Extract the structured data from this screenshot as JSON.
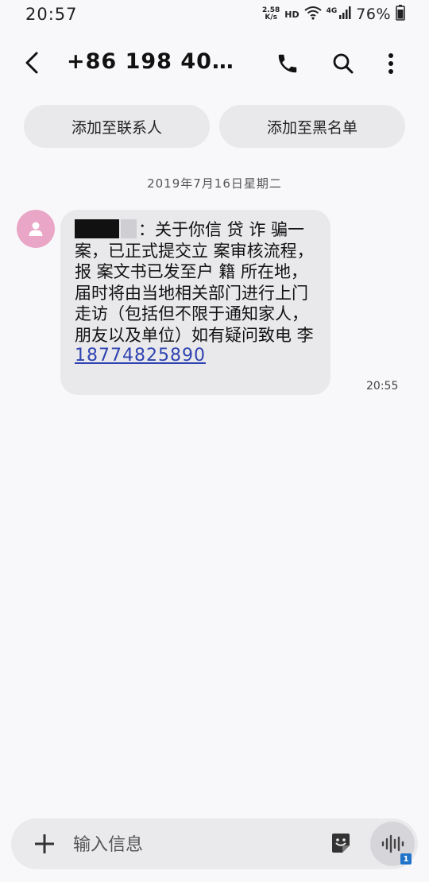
{
  "status_bar": {
    "time": "20:57",
    "net_speed_value": "2.58",
    "net_speed_unit": "K/s",
    "hd": "HD",
    "network": "4G",
    "battery": "76%"
  },
  "app_bar": {
    "contact": "+86 198 40…"
  },
  "actions": {
    "add_contact": "添加至联系人",
    "add_blacklist": "添加至黑名单"
  },
  "conversation": {
    "date": "2019年7月16日星期二",
    "message": {
      "text": "：关于你信 贷 诈 骗一案，已正式提交立 案审核流程，报 案文书已发至户 籍 所在地，届时将由当地相关部门进行上门走访（包括但不限于通知家人，朋友以及单位）如有疑问致电 李",
      "phone_link": "18774825890",
      "time": "20:55"
    }
  },
  "composer": {
    "placeholder": "输入信息",
    "sim_slot": "1"
  }
}
